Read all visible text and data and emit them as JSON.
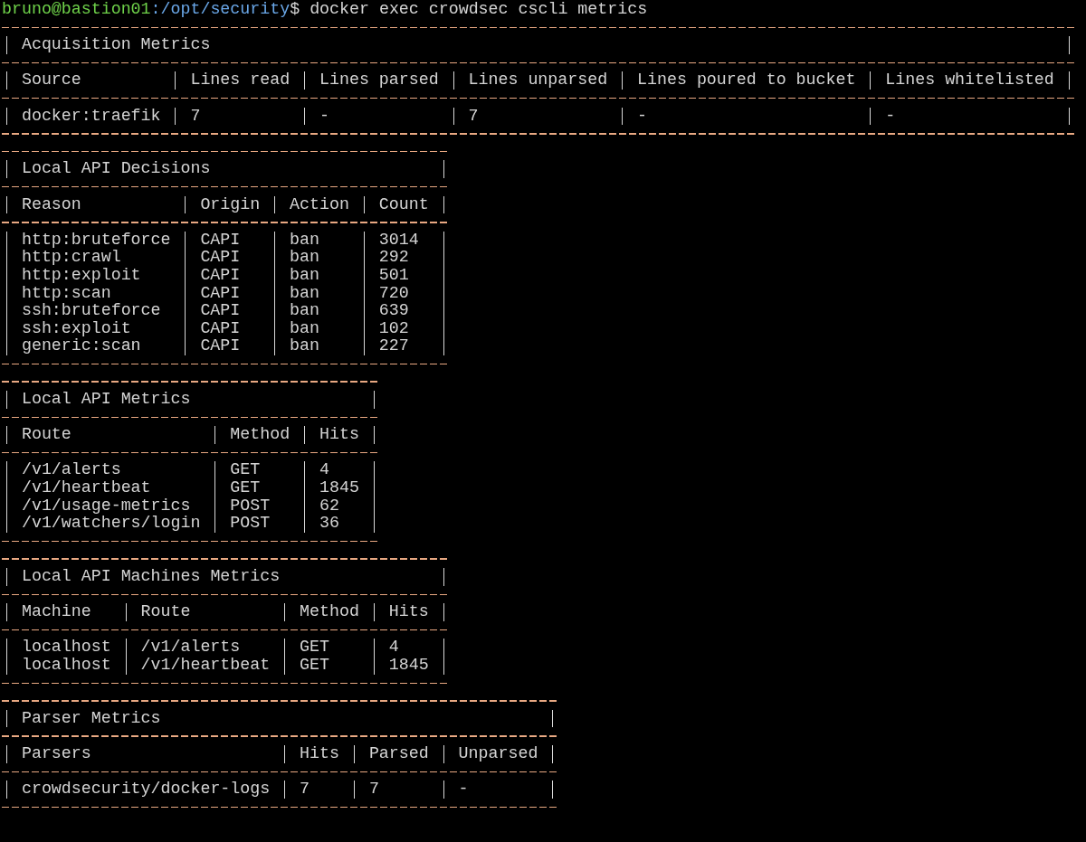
{
  "prompt": {
    "user_host": "bruno@bastion01",
    "path": ":/opt/security",
    "symbol": "$",
    "command": "docker exec crowdsec cscli metrics"
  },
  "tables": [
    {
      "title": "Acquisition Metrics",
      "columns": [
        "Source",
        "Lines read",
        "Lines parsed",
        "Lines unparsed",
        "Lines poured to bucket",
        "Lines whitelisted"
      ],
      "rows": [
        [
          "docker:traefik",
          "7",
          "-",
          "7",
          "-",
          "-"
        ]
      ]
    },
    {
      "title": "Local API Decisions",
      "columns": [
        "Reason",
        "Origin",
        "Action",
        "Count"
      ],
      "rows": [
        [
          "http:bruteforce",
          "CAPI",
          "ban",
          "3014"
        ],
        [
          "http:crawl",
          "CAPI",
          "ban",
          "292"
        ],
        [
          "http:exploit",
          "CAPI",
          "ban",
          "501"
        ],
        [
          "http:scan",
          "CAPI",
          "ban",
          "720"
        ],
        [
          "ssh:bruteforce",
          "CAPI",
          "ban",
          "639"
        ],
        [
          "ssh:exploit",
          "CAPI",
          "ban",
          "102"
        ],
        [
          "generic:scan",
          "CAPI",
          "ban",
          "227"
        ]
      ]
    },
    {
      "title": "Local API Metrics",
      "columns": [
        "Route",
        "Method",
        "Hits"
      ],
      "rows": [
        [
          "/v1/alerts",
          "GET",
          "4"
        ],
        [
          "/v1/heartbeat",
          "GET",
          "1845"
        ],
        [
          "/v1/usage-metrics",
          "POST",
          "62"
        ],
        [
          "/v1/watchers/login",
          "POST",
          "36"
        ]
      ]
    },
    {
      "title": "Local API Machines Metrics",
      "columns": [
        "Machine",
        "Route",
        "Method",
        "Hits"
      ],
      "rows": [
        [
          "localhost",
          "/v1/alerts",
          "GET",
          "4"
        ],
        [
          "localhost",
          "/v1/heartbeat",
          "GET",
          "1845"
        ]
      ]
    },
    {
      "title": "Parser Metrics",
      "columns": [
        "Parsers",
        "Hits",
        "Parsed",
        "Unparsed"
      ],
      "rows": [
        [
          "crowdsecurity/docker-logs",
          "7",
          "7",
          "-"
        ]
      ]
    }
  ]
}
